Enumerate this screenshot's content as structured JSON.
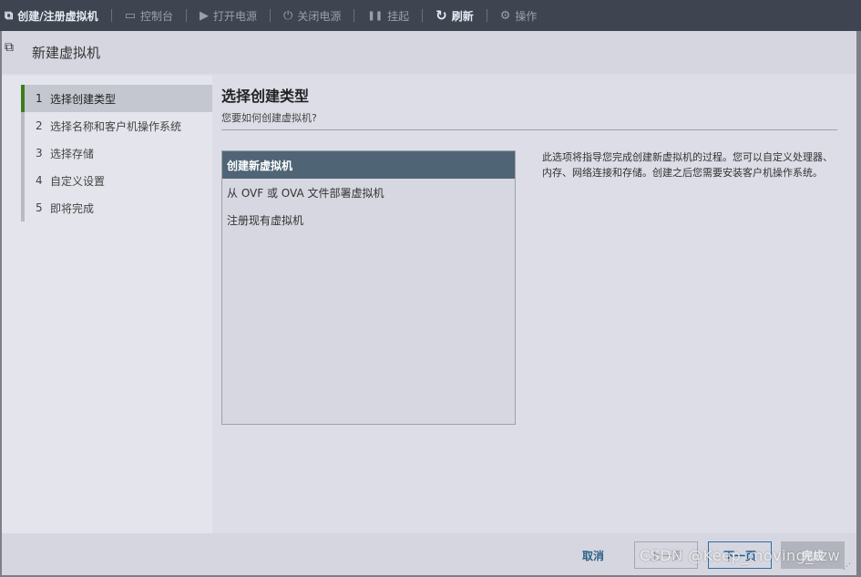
{
  "toolbar": {
    "items": [
      {
        "label": "创建/注册虚拟机",
        "icon": "add-vm-icon",
        "glyph": "⧉"
      },
      {
        "label": "控制台",
        "icon": "console-icon",
        "glyph": "▭"
      },
      {
        "label": "打开电源",
        "icon": "play-icon",
        "glyph": "▶"
      },
      {
        "label": "关闭电源",
        "icon": "power-icon",
        "glyph": "⏻"
      },
      {
        "label": "挂起",
        "icon": "pause-icon",
        "glyph": "❚❚"
      },
      {
        "label": "刷新",
        "icon": "refresh-icon",
        "glyph": "↻"
      },
      {
        "label": "操作",
        "icon": "gear-icon",
        "glyph": "⚙"
      }
    ]
  },
  "dialog": {
    "title": "新建虚拟机",
    "title_icon": "new-vm-icon"
  },
  "steps": [
    {
      "num": "1",
      "label": "选择创建类型",
      "active": true
    },
    {
      "num": "2",
      "label": "选择名称和客户机操作系统",
      "active": false
    },
    {
      "num": "3",
      "label": "选择存储",
      "active": false
    },
    {
      "num": "4",
      "label": "自定义设置",
      "active": false
    },
    {
      "num": "5",
      "label": "即将完成",
      "active": false
    }
  ],
  "content": {
    "title": "选择创建类型",
    "subtitle": "您要如何创建虚拟机?",
    "options": [
      {
        "label": "创建新虚拟机",
        "selected": true
      },
      {
        "label": "从 OVF 或 OVA 文件部署虚拟机",
        "selected": false
      },
      {
        "label": "注册现有虚拟机",
        "selected": false
      }
    ],
    "description": "此选项将指导您完成创建新虚拟机的过程。您可以自定义处理器、内存、网络连接和存储。创建之后您需要安装客户机操作系统。"
  },
  "footer": {
    "cancel": "取消",
    "prev": "上一页",
    "next": "下一页",
    "finish": "完成"
  },
  "watermark": "CSDN @Keep_moving_tzw",
  "colors": {
    "toolbar_bg": "#3f4550",
    "selected_option_bg": "#4f6575",
    "active_step_bar": "#3e7d1a",
    "primary_link": "#1f5f9a"
  }
}
